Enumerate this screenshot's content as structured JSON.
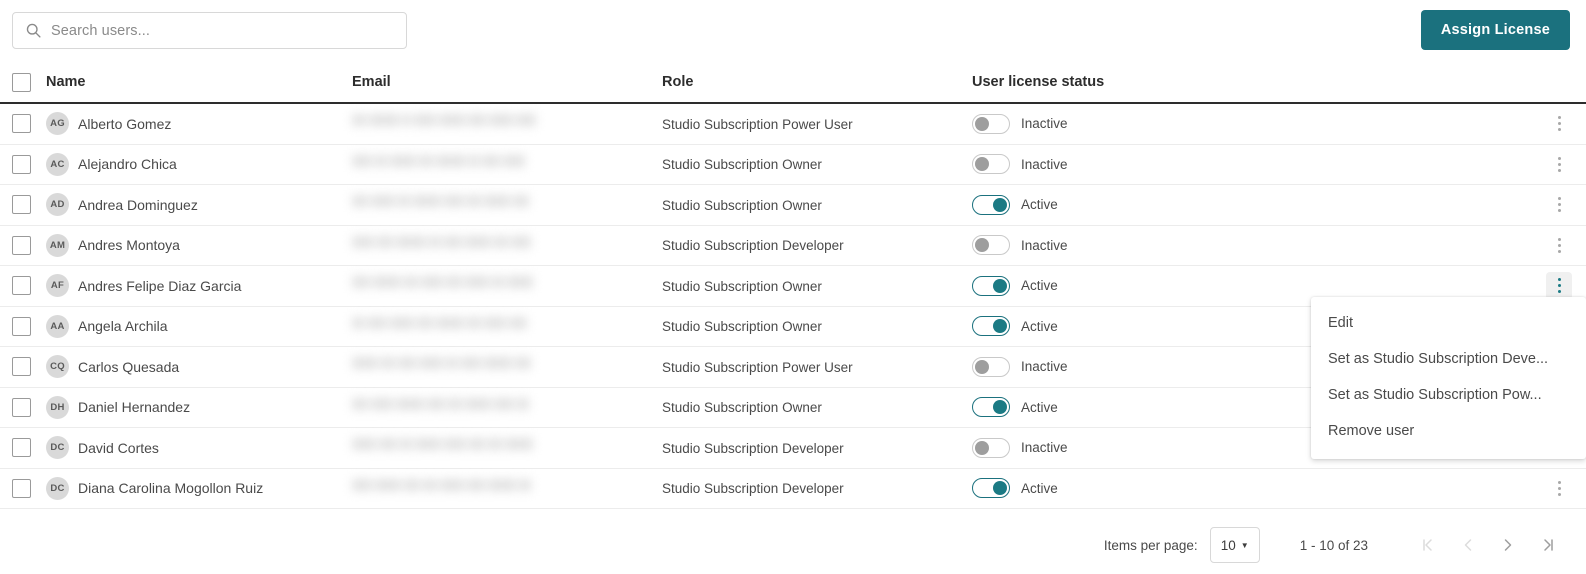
{
  "search": {
    "placeholder": "Search users...",
    "value": "",
    "icon": "search-icon"
  },
  "assign_button": {
    "label": "Assign License",
    "color": "#1b717e"
  },
  "table": {
    "columns": [
      "Name",
      "Email",
      "Role",
      "User license status"
    ],
    "rows": [
      {
        "initials": "AG",
        "name": "Alberto Gomez",
        "email": "",
        "role": "Studio Subscription Power User",
        "status": "Inactive",
        "active": false,
        "menu_open": false
      },
      {
        "initials": "AC",
        "name": "Alejandro Chica",
        "email": "",
        "role": "Studio Subscription Owner",
        "status": "Inactive",
        "active": false,
        "menu_open": false
      },
      {
        "initials": "AD",
        "name": "Andrea Dominguez",
        "email": "",
        "role": "Studio Subscription Owner",
        "status": "Active",
        "active": true,
        "menu_open": false
      },
      {
        "initials": "AM",
        "name": "Andres Montoya",
        "email": "",
        "role": "Studio Subscription Developer",
        "status": "Inactive",
        "active": false,
        "menu_open": false
      },
      {
        "initials": "AF",
        "name": "Andres Felipe Diaz Garcia",
        "email": "",
        "role": "Studio Subscription Owner",
        "status": "Active",
        "active": true,
        "menu_open": true
      },
      {
        "initials": "AA",
        "name": "Angela Archila",
        "email": "",
        "role": "Studio Subscription Owner",
        "status": "Active",
        "active": true,
        "menu_open": false
      },
      {
        "initials": "CQ",
        "name": "Carlos Quesada",
        "email": "",
        "role": "Studio Subscription Power User",
        "status": "Inactive",
        "active": false,
        "menu_open": false
      },
      {
        "initials": "DH",
        "name": "Daniel Hernandez",
        "email": "",
        "role": "Studio Subscription Owner",
        "status": "Active",
        "active": true,
        "menu_open": false
      },
      {
        "initials": "DC",
        "name": "David Cortes",
        "email": "",
        "role": "Studio Subscription Developer",
        "status": "Inactive",
        "active": false,
        "menu_open": false
      },
      {
        "initials": "DC",
        "name": "Diana Carolina Mogollon Ruiz",
        "email": "",
        "role": "Studio Subscription Developer",
        "status": "Active",
        "active": true,
        "menu_open": false
      }
    ]
  },
  "context_menu": {
    "items": [
      "Edit",
      "Set as Studio Subscription Deve...",
      "Set as Studio Subscription Pow...",
      "Remove user"
    ]
  },
  "pagination": {
    "items_per_page_label": "Items per page:",
    "items_per_page_value": "10",
    "range": "1 - 10 of 23",
    "first_icon": "first-page-icon",
    "prev_icon": "previous-page-icon",
    "next_icon": "next-page-icon",
    "last_icon": "last-page-icon"
  }
}
